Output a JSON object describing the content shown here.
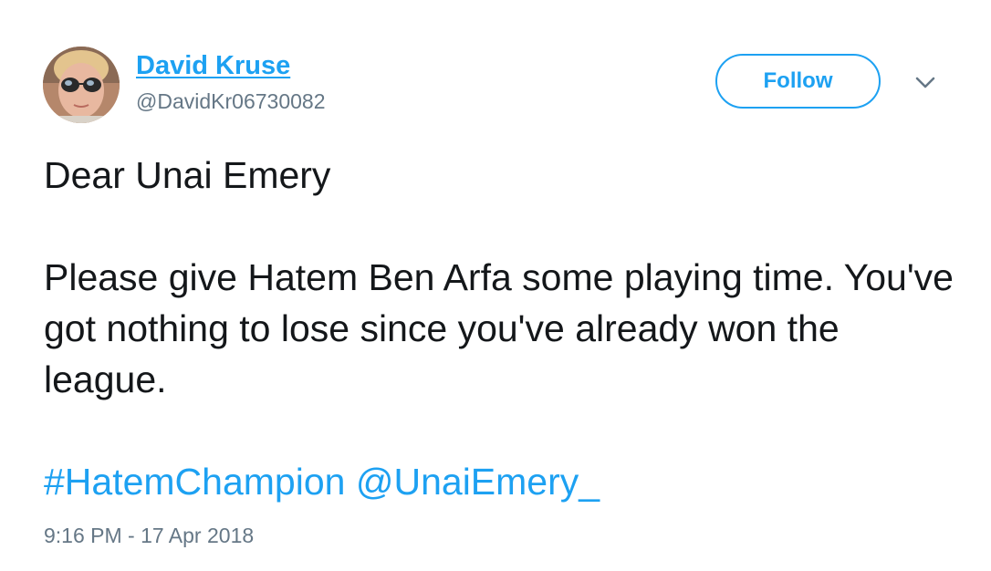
{
  "tweet": {
    "author": {
      "display_name": "David Kruse",
      "handle": "@DavidKr06730082",
      "avatar_icon": "profile-photo-sunglasses"
    },
    "follow_label": "Follow",
    "more_icon": "chevron-down-icon",
    "text": {
      "line1": "Dear Unai Emery",
      "line2": "Please give Hatem Ben Arfa some playing time. You've got nothing to lose since you've already won the league."
    },
    "hashtag": "#HatemChampion",
    "mention": "@UnaiEmery_",
    "timestamp": "9:16 PM - 17 Apr 2018"
  },
  "colors": {
    "accent": "#1da1f2",
    "text": "#14171a",
    "secondary": "#657786"
  }
}
